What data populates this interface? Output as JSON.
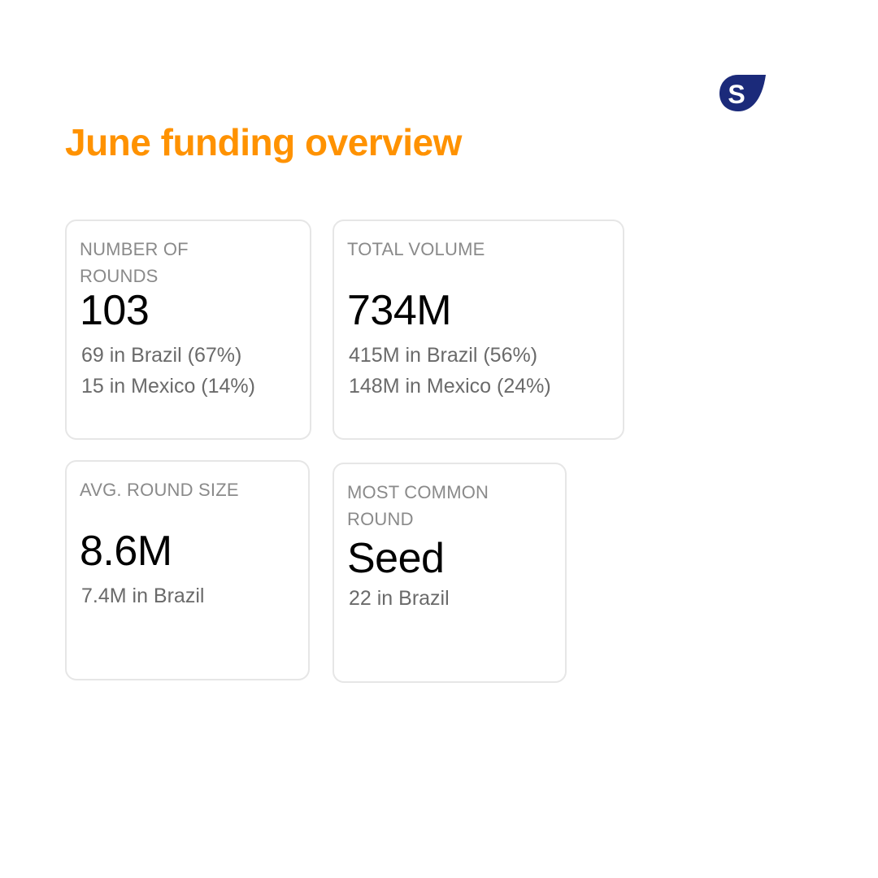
{
  "title": "June funding overview",
  "logo": {
    "icon": "brand-logo-icon",
    "letter": "S",
    "color": "#1b2a7a"
  },
  "colors": {
    "title": "#ff9200",
    "label": "#8a8a8a",
    "value": "#000000",
    "detail": "#6a6a6a",
    "card_border": "#e6e6e6"
  },
  "cards": [
    {
      "label": "NUMBER OF ROUNDS",
      "value": "103",
      "details": [
        "69 in Brazil (67%)",
        "15 in Mexico (14%)"
      ]
    },
    {
      "label": "TOTAL VOLUME",
      "value": "734M",
      "details": [
        "415M in Brazil (56%)",
        "148M in Mexico (24%)"
      ]
    },
    {
      "label": "AVG. ROUND SIZE",
      "value": "8.6M",
      "details": [
        "7.4M in Brazil"
      ]
    },
    {
      "label": "MOST COMMON ROUND",
      "value": "Seed",
      "details": [
        "22 in Brazil"
      ]
    }
  ]
}
